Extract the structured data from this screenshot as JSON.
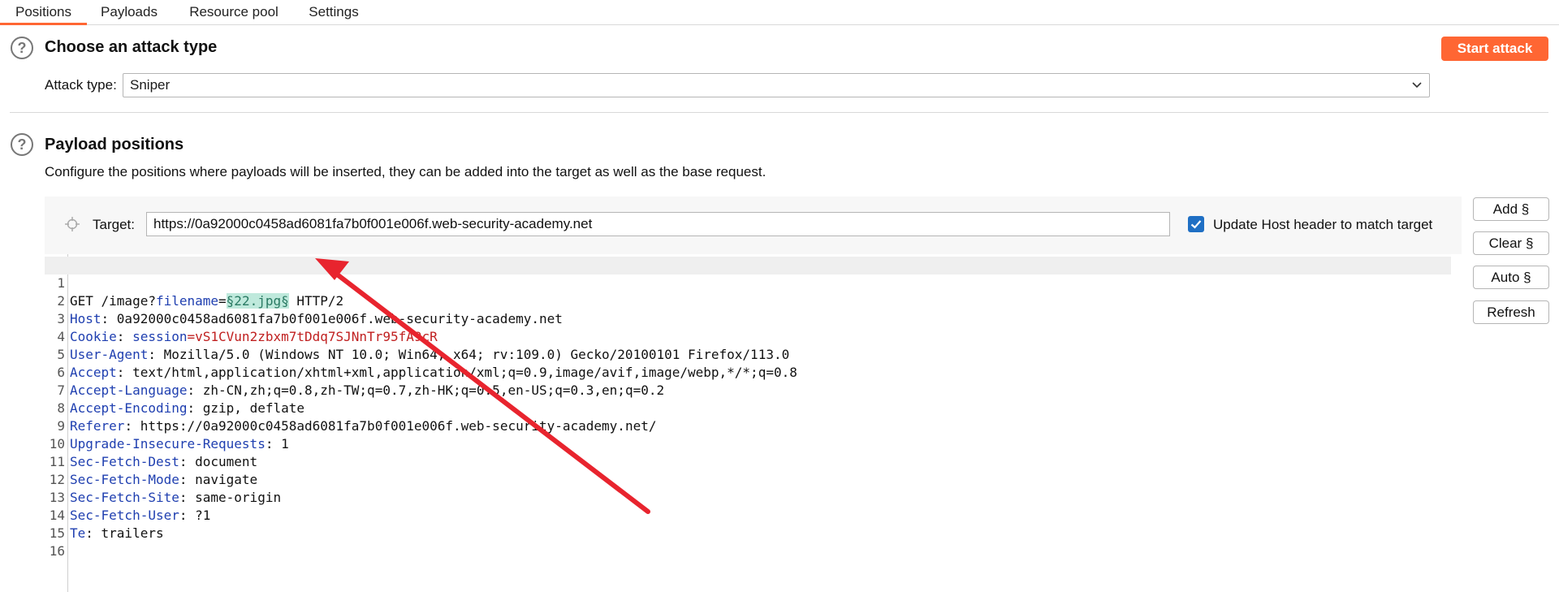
{
  "tabs": [
    {
      "label": "Positions",
      "active": true
    },
    {
      "label": "Payloads",
      "active": false
    },
    {
      "label": "Resource pool",
      "active": false
    },
    {
      "label": "Settings",
      "active": false
    }
  ],
  "attack_section": {
    "title": "Choose an attack type",
    "start_button": "Start attack",
    "attack_type_label": "Attack type:",
    "attack_type_value": "Sniper"
  },
  "payload_section": {
    "title": "Payload positions",
    "description": "Configure the positions where payloads will be inserted, they can be added into the target as well as the base request.",
    "target_label": "Target:",
    "target_value": "https://0a92000c0458ad6081fa7b0f001e006f.web-security-academy.net",
    "update_host_label": "Update Host header to match target",
    "update_host_checked": true
  },
  "side_buttons": [
    "Add §",
    "Clear §",
    "Auto §",
    "Refresh"
  ],
  "request_lines": [
    {
      "n": "1",
      "pre": "GET /image?",
      "name": "filename",
      "sep": "=",
      "payload": "§22.jpg§",
      "post": " HTTP/2"
    },
    {
      "n": "2",
      "name": "Host",
      "rest": ": 0a92000c0458ad6081fa7b0f001e006f.web-security-academy.net"
    },
    {
      "n": "3",
      "name": "Cookie",
      "rest": ": ",
      "cname": "session",
      "cval": "=vS1CVun2zbxm7tDdq7SJNnTr95fA9cR"
    },
    {
      "n": "4",
      "name": "User-Agent",
      "rest": ": Mozilla/5.0 (Windows NT 10.0; Win64; x64; rv:109.0) Gecko/20100101 Firefox/113.0"
    },
    {
      "n": "5",
      "name": "Accept",
      "rest": ": text/html,application/xhtml+xml,application/xml;q=0.9,image/avif,image/webp,*/*;q=0.8"
    },
    {
      "n": "6",
      "name": "Accept-Language",
      "rest": ": zh-CN,zh;q=0.8,zh-TW;q=0.7,zh-HK;q=0.5,en-US;q=0.3,en;q=0.2"
    },
    {
      "n": "7",
      "name": "Accept-Encoding",
      "rest": ": gzip, deflate"
    },
    {
      "n": "8",
      "name": "Referer",
      "rest": ": https://0a92000c0458ad6081fa7b0f001e006f.web-security-academy.net/"
    },
    {
      "n": "9",
      "name": "Upgrade-Insecure-Requests",
      "rest": ": 1"
    },
    {
      "n": "10",
      "name": "Sec-Fetch-Dest",
      "rest": ": document"
    },
    {
      "n": "11",
      "name": "Sec-Fetch-Mode",
      "rest": ": navigate"
    },
    {
      "n": "12",
      "name": "Sec-Fetch-Site",
      "rest": ": same-origin"
    },
    {
      "n": "13",
      "name": "Sec-Fetch-User",
      "rest": ": ?1"
    },
    {
      "n": "14",
      "name": "Te",
      "rest": ": trailers"
    },
    {
      "n": "15"
    },
    {
      "n": "16"
    }
  ],
  "colors": {
    "accent": "#ff6633",
    "header_name": "#1f3fb0",
    "cookie_value": "#c02020",
    "payload_bg": "#bfe9dc",
    "annotation_arrow": "#e8242e"
  },
  "icons": {
    "help": "help-circle-icon",
    "target": "crosshair-icon",
    "checkbox": "checkmark-icon",
    "dropdown": "chevron-down-icon"
  }
}
